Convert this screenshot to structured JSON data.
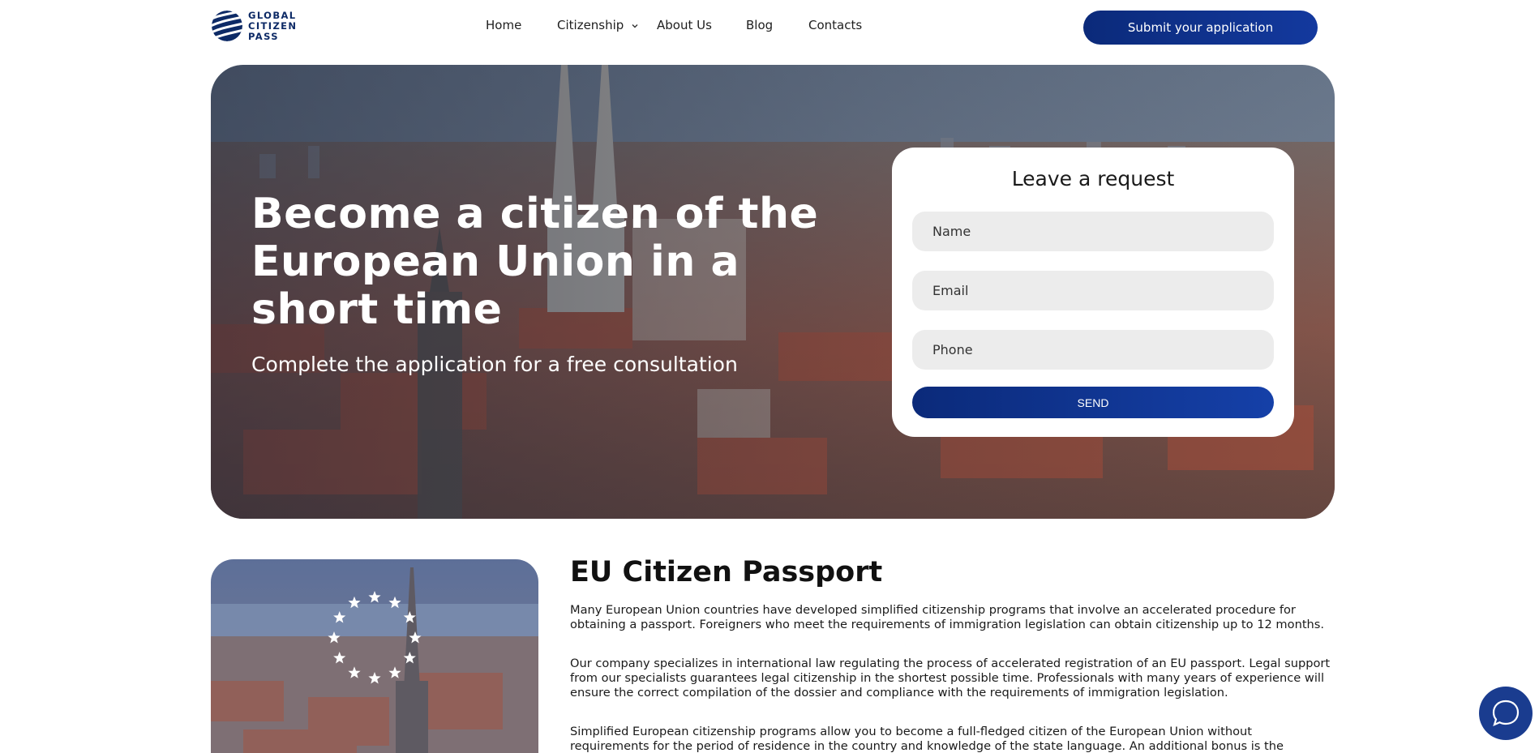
{
  "logo": {
    "line1": "GLOBAL",
    "line2": "CITIZEN",
    "line3": "PASS"
  },
  "nav": {
    "items": [
      {
        "label": "Home"
      },
      {
        "label": "Citizenship",
        "has_dropdown": true
      },
      {
        "label": "About Us"
      },
      {
        "label": "Blog"
      },
      {
        "label": "Contacts"
      }
    ],
    "cta_label": "Submit your application"
  },
  "hero": {
    "title": "Become a citizen of the European Union in a short time",
    "subtitle": "Complete the application for a free consultation",
    "form": {
      "title": "Leave a request",
      "name_placeholder": "Name",
      "email_placeholder": "Email",
      "phone_placeholder": "Phone",
      "send_label": "SEND"
    }
  },
  "section": {
    "title": "EU Citizen Passport",
    "paragraphs": [
      "Many European Union countries have developed simplified citizenship programs that involve an accelerated procedure for obtaining a passport. Foreigners who meet the requirements of immigration legislation can obtain citizenship up to 12 months.",
      "Our company specializes in international law regulating the process of accelerated registration of an EU passport. Legal support from our specialists guarantees legal citizenship in the shortest possible time. Professionals with many years of experience will ensure the correct compilation of the dossier and compliance with the requirements of immigration legislation.",
      "Simplified European citizenship programs allow you to become a full-fledged citizen of the European Union without requirements for the period of residence in the country and knowledge of the state language. An additional bonus is the opportunity to save the"
    ]
  },
  "icons": {
    "logo": "globe-stripes-icon",
    "chevron": "chevron-down-icon",
    "chat": "chat-bubble-icon",
    "eu_flag_stars": "eu-stars-icon"
  },
  "colors": {
    "brand_blue": "#0b2a7a",
    "field_bg": "#ececec",
    "chat_blue": "#1a3c8f"
  }
}
